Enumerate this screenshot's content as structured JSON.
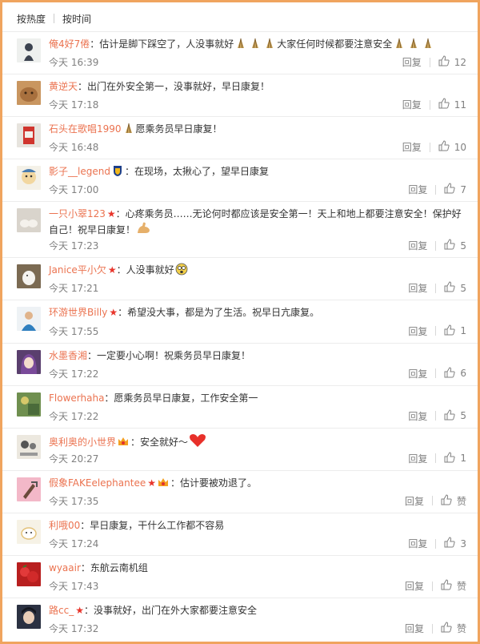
{
  "tabs": {
    "hot": "按热度",
    "time": "按时间"
  },
  "reply_label": "回复",
  "colors": {
    "name": "#eb7350",
    "border": "#f0a45e",
    "text": "#333333",
    "meta": "#808080"
  },
  "comments": [
    {
      "name": "俺4好7倦",
      "text": "：估计是脚下踩空了，人没事就好",
      "text2": "大家任何时候都要注意安全",
      "time": "今天 16:39",
      "likes": "12"
    },
    {
      "name": "黄逆天",
      "text": "：出门在外安全第一，没事就好，早日康复！",
      "time": "今天 17:18",
      "likes": "11"
    },
    {
      "name": "石头在歌唱1990",
      "text": "愿乘务员早日康复！",
      "time": "今天 16:48",
      "likes": "10"
    },
    {
      "name": "影子__legend",
      "text": "：在现场，太揪心了，望早日康复",
      "time": "今天 17:00",
      "likes": "7"
    },
    {
      "name": "一只小翠123",
      "text": "：心疼乘务员……无论何时都应该是安全第一！天上和地上都要注意安全！保护好自己！祝早日康复！",
      "time": "今天 17:23",
      "likes": "5"
    },
    {
      "name": "Janice平小欠",
      "text": "：人没事就好",
      "time": "今天 17:21",
      "likes": "5"
    },
    {
      "name": "环游世界Billy",
      "text": "：希望没大事，都是为了生活。祝早日亢康复。",
      "time": "今天 17:55",
      "likes": "1"
    },
    {
      "name": "水墨香湘",
      "text": "：一定要小心啊！祝乘务员早日康复！",
      "time": "今天 17:22",
      "likes": "6"
    },
    {
      "name": "Flowerhaha",
      "text": "：愿乘务员早日康复，工作安全第一",
      "time": "今天 17:22",
      "likes": "5"
    },
    {
      "name": "奥利奥的小世界",
      "text": "：安全就好～",
      "time": "今天 20:27",
      "likes": "1"
    },
    {
      "name": "假象FAKEelephantee",
      "text": "：估计要被劝退了。",
      "time": "今天 17:35",
      "likes": "赞"
    },
    {
      "name": "利哦00",
      "text": "：早日康复，干什么工作都不容易",
      "time": "今天 17:24",
      "likes": "3"
    },
    {
      "name": "wyaair",
      "text": "：东航云南机组",
      "time": "今天 17:43",
      "likes": "赞"
    },
    {
      "name": "路cc_",
      "text": "：没事就好，出门在外大家都要注意安全",
      "time": "今天 17:32",
      "likes": "赞"
    }
  ]
}
